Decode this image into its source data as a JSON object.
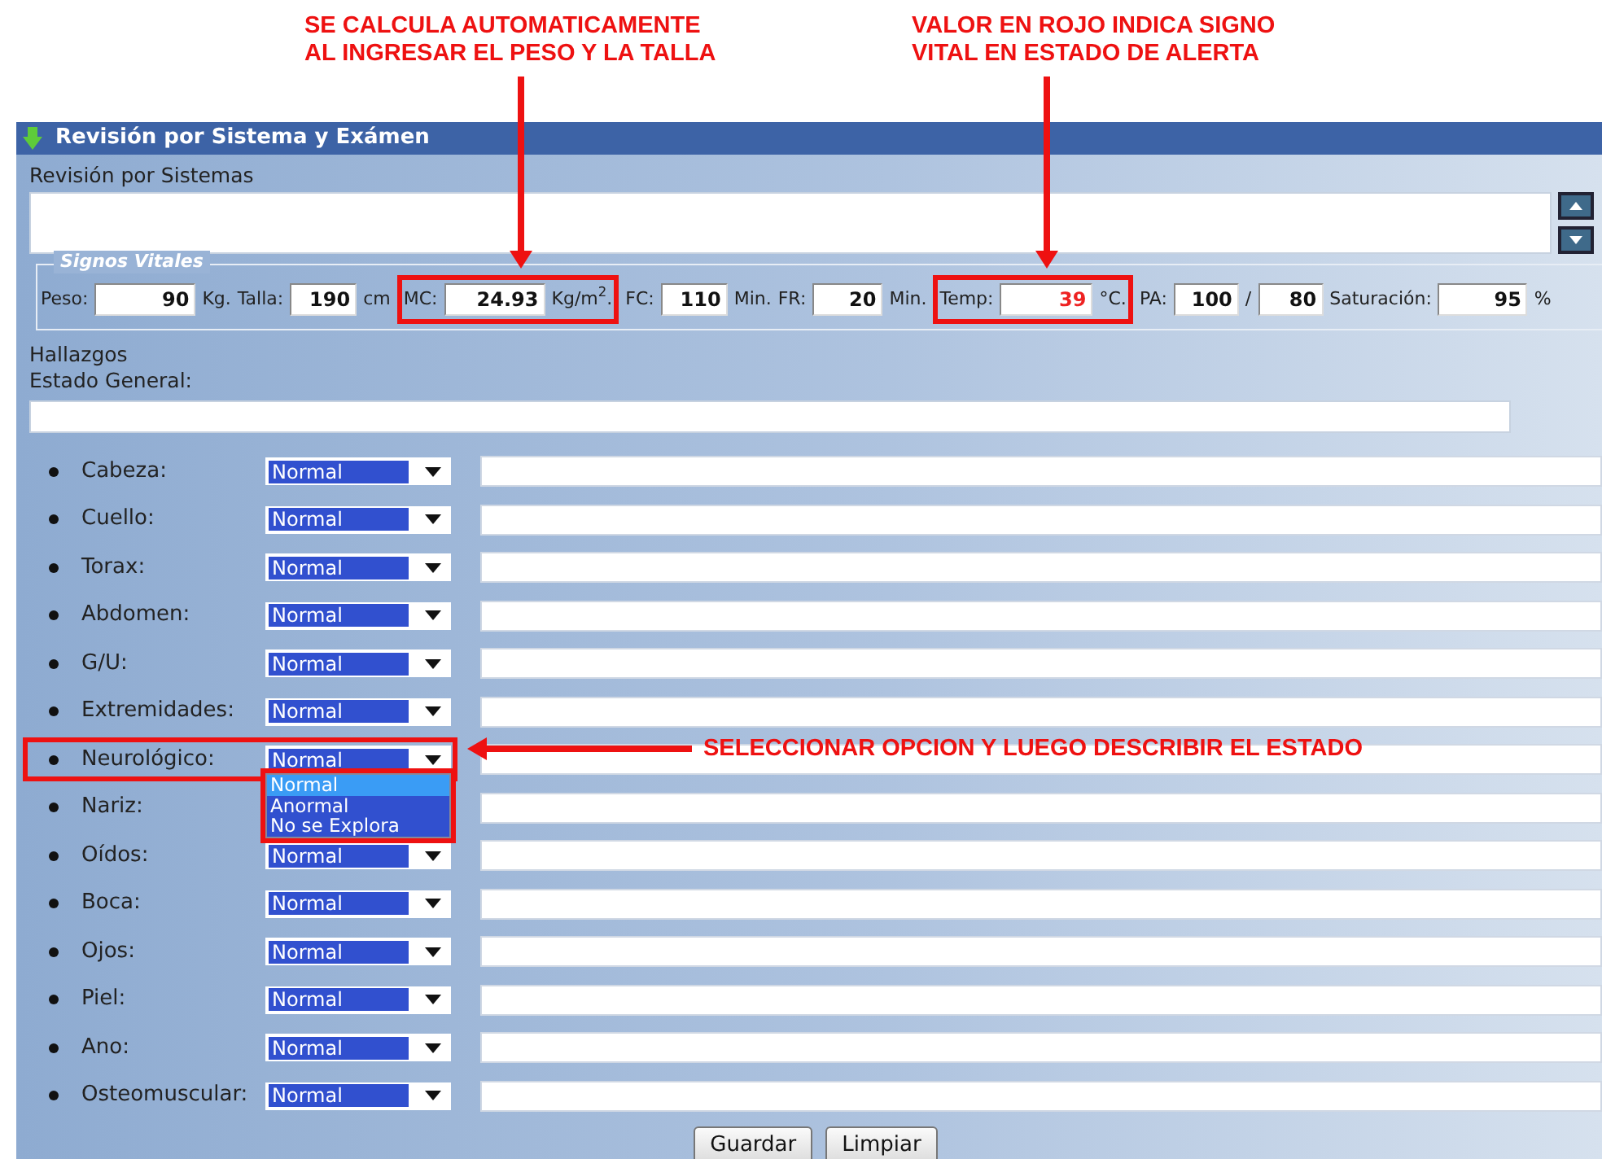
{
  "annotations": [
    {
      "lines": [
        "SE CALCULA AUTOMATICAMENTE",
        "AL INGRESAR EL PESO Y LA TALLA"
      ]
    },
    {
      "lines": [
        "VALOR EN ROJO  INDICA SIGNO",
        "VITAL EN ESTADO DE ALERTA"
      ]
    },
    {
      "lines": [
        "SELECCIONAR OPCION Y LUEGO DESCRIBIR EL ESTADO"
      ]
    }
  ],
  "panel": {
    "title": "Revisión por Sistema y Exámen"
  },
  "review": {
    "label": "Revisión por Sistemas"
  },
  "vitals": {
    "legend": "Signos Vitales",
    "groups": [
      {
        "highlighted": false,
        "items": [
          {
            "kind": "label",
            "text": "Peso:"
          },
          {
            "kind": "input",
            "value": "90",
            "alert": false
          },
          {
            "kind": "label",
            "text": "Kg."
          },
          {
            "kind": "label",
            "text": "Talla:"
          },
          {
            "kind": "input",
            "value": "190",
            "alert": false
          },
          {
            "kind": "label",
            "text": "cm"
          }
        ]
      },
      {
        "highlighted": true,
        "items": [
          {
            "kind": "label",
            "text": "MC:"
          },
          {
            "kind": "input",
            "value": "24.93",
            "alert": false
          },
          {
            "kind": "label",
            "text": "Kg/m$^{2}$."
          }
        ]
      },
      {
        "highlighted": false,
        "items": [
          {
            "kind": "label",
            "text": "FC:"
          },
          {
            "kind": "input",
            "value": "110",
            "alert": false
          },
          {
            "kind": "label",
            "text": "Min."
          },
          {
            "kind": "label",
            "text": "FR:"
          },
          {
            "kind": "input",
            "value": "20",
            "alert": false
          },
          {
            "kind": "label",
            "text": "Min."
          }
        ]
      },
      {
        "highlighted": true,
        "items": [
          {
            "kind": "label",
            "text": "Temp:"
          },
          {
            "kind": "input",
            "value": "39",
            "alert": true
          },
          {
            "kind": "label",
            "text": "°C."
          }
        ]
      },
      {
        "highlighted": false,
        "items": [
          {
            "kind": "label",
            "text": "PA:"
          },
          {
            "kind": "input",
            "value": "100",
            "alert": false
          },
          {
            "kind": "label",
            "text": "/"
          },
          {
            "kind": "input",
            "value": "80",
            "alert": false
          },
          {
            "kind": "label",
            "text": "Saturación:"
          },
          {
            "kind": "input",
            "value": "95",
            "alert": false
          },
          {
            "kind": "label",
            "text": "%"
          }
        ]
      }
    ]
  },
  "findings": {
    "heading": "Hallazgos",
    "general_label": "Estado General:"
  },
  "systems": [
    {
      "label": "Cabeza:",
      "value": "Normal",
      "highlighted": false
    },
    {
      "label": "Cuello:",
      "value": "Normal",
      "highlighted": false
    },
    {
      "label": "Torax:",
      "value": "Normal",
      "highlighted": false
    },
    {
      "label": "Abdomen:",
      "value": "Normal",
      "highlighted": false
    },
    {
      "label": "G/U:",
      "value": "Normal",
      "highlighted": false
    },
    {
      "label": "Extremidades:",
      "value": "Normal",
      "highlighted": false
    },
    {
      "label": "Neurológico:",
      "value": "Normal",
      "highlighted": true,
      "options": [
        {
          "text": "Normal",
          "selected": true
        },
        {
          "text": "Anormal",
          "selected": false
        },
        {
          "text": "No se Explora",
          "selected": false
        }
      ]
    },
    {
      "label": "Nariz:",
      "highlighted": false
    },
    {
      "label": "Oídos:",
      "value": "Normal",
      "highlighted": false
    },
    {
      "label": "Boca:",
      "value": "Normal",
      "highlighted": false
    },
    {
      "label": "Ojos:",
      "value": "Normal",
      "highlighted": false
    },
    {
      "label": "Piel:",
      "value": "Normal",
      "highlighted": false
    },
    {
      "label": "Ano:",
      "value": "Normal",
      "highlighted": false
    },
    {
      "label": "Osteomuscular:",
      "value": "Normal",
      "highlighted": false
    }
  ],
  "buttons": [
    "Guardar",
    "Limpiar"
  ]
}
